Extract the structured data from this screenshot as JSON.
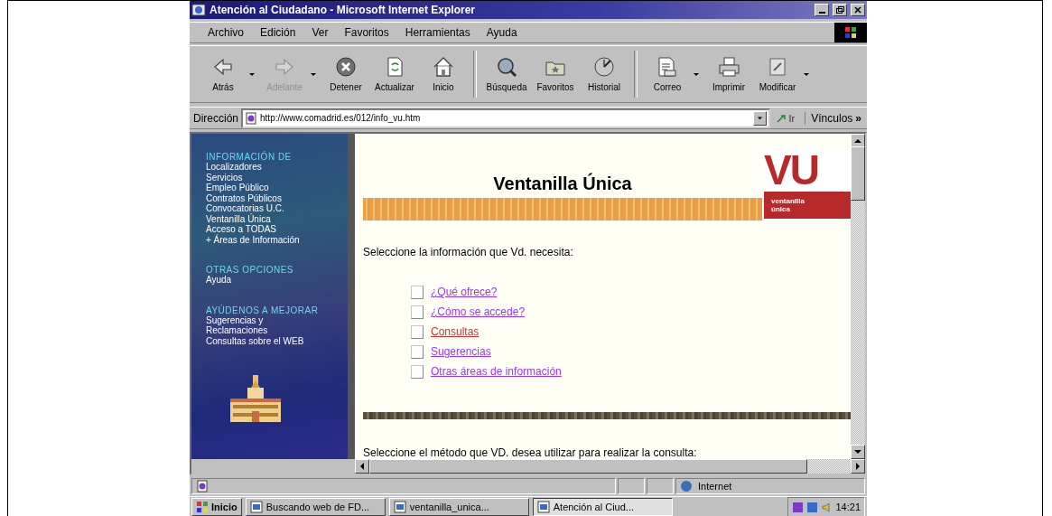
{
  "window": {
    "title": "Atención al Ciudadano - Microsoft Internet Explorer"
  },
  "menu": [
    "Archivo",
    "Edición",
    "Ver",
    "Favoritos",
    "Herramientas",
    "Ayuda"
  ],
  "toolbar": [
    {
      "kind": "back",
      "label": "Atrás",
      "disabled": false,
      "dropdown": true
    },
    {
      "kind": "forward",
      "label": "Adelante",
      "disabled": true,
      "dropdown": true
    },
    {
      "kind": "stop",
      "label": "Detener",
      "disabled": false,
      "dropdown": false
    },
    {
      "kind": "refresh",
      "label": "Actualizar",
      "disabled": false,
      "dropdown": false
    },
    {
      "kind": "home",
      "label": "Inicio",
      "disabled": false,
      "dropdown": false
    },
    {
      "kind": "search",
      "label": "Búsqueda",
      "disabled": false,
      "dropdown": false
    },
    {
      "kind": "favorites",
      "label": "Favoritos",
      "disabled": false,
      "dropdown": false
    },
    {
      "kind": "history",
      "label": "Historial",
      "disabled": false,
      "dropdown": false
    },
    {
      "kind": "mail",
      "label": "Correo",
      "disabled": false,
      "dropdown": true
    },
    {
      "kind": "print",
      "label": "Imprimir",
      "disabled": false,
      "dropdown": false
    },
    {
      "kind": "edit",
      "label": "Modificar",
      "disabled": false,
      "dropdown": true
    }
  ],
  "address_bar": {
    "label": "Dirección",
    "value": "http://www.comadrid.es/012/info_vu.htm",
    "go": "Ir",
    "links": "Vínculos",
    "more": "»"
  },
  "sidebar": {
    "sections": [
      {
        "heading": "INFORMACIÓN DE",
        "items": [
          "Localizadores",
          "Servicios",
          "Empleo Público",
          "Contratos Públicos",
          "Convocatorias U.C.",
          "Ventanilla Única",
          "Acceso a TODAS",
          "+ Áreas de Información"
        ]
      },
      {
        "heading": "OTRAS OPCIONES",
        "items": [
          "Ayuda"
        ]
      },
      {
        "heading": "AYÚDENOS A MEJORAR",
        "items": [
          "Sugerencias y",
          "Reclamaciones",
          "Consultas sobre el WEB"
        ]
      }
    ]
  },
  "page": {
    "title": "Ventanilla Única",
    "logo": {
      "letters": "VU",
      "caption_lines": [
        "ventanilla",
        "única"
      ]
    },
    "prompt": "Seleccione la información que Vd. necesita:",
    "links": [
      {
        "label": "¿Qué ofrece?",
        "color": "#9933ff"
      },
      {
        "label": "¿Cómo se accede?",
        "color": "#9933ff"
      },
      {
        "label": "Consultas",
        "color": "#cc3333"
      },
      {
        "label": "Sugerencias",
        "color": "#9933ff"
      },
      {
        "label": "Otras áreas de información",
        "color": "#9933ff"
      }
    ],
    "prompt_2": "Seleccione el método que VD. desea utilizar para realizar la consulta:"
  },
  "status_bar": {
    "zone": "Internet"
  },
  "taskbar": {
    "start": "Inicio",
    "tasks": [
      {
        "label": "Buscando web de FD...",
        "selected": false
      },
      {
        "label": "ventanilla_unica...",
        "selected": false
      },
      {
        "label": "Atención al Ciud...",
        "selected": true
      }
    ],
    "clock": "14:21"
  }
}
